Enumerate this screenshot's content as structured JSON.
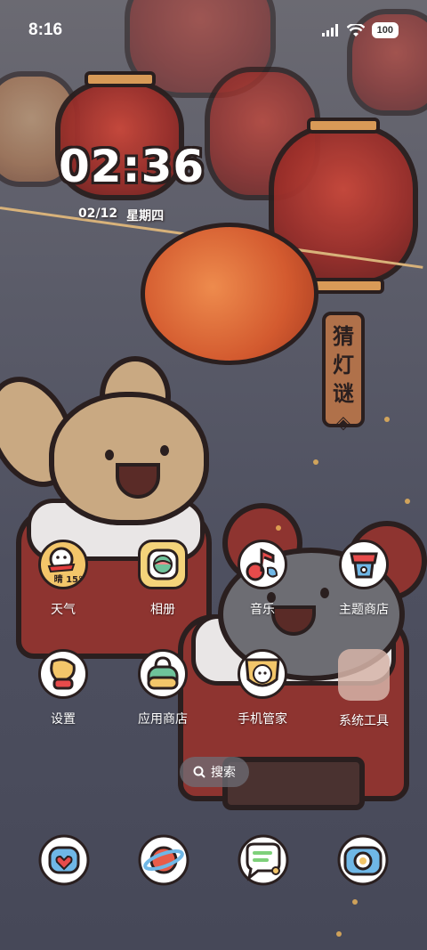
{
  "status_bar": {
    "time": "8:16",
    "battery": "100",
    "icons": [
      "signal-icon",
      "wifi-icon",
      "battery-icon"
    ]
  },
  "clock_widget": {
    "time": "02:36",
    "date": "02/12",
    "weekday": "星期四"
  },
  "wallpaper": {
    "tag_chars": [
      "猜",
      "灯",
      "谜"
    ],
    "tag_symbol": "◈"
  },
  "apps": [
    {
      "id": "weather",
      "label": "天气",
      "icon": "weather-icon",
      "inner_text": "晴 15°",
      "color": "#f3c66a"
    },
    {
      "id": "gallery",
      "label": "相册",
      "icon": "gallery-icon",
      "color": "#f4d37a"
    },
    {
      "id": "music",
      "label": "音乐",
      "icon": "music-icon",
      "color": "#e74b4b"
    },
    {
      "id": "theme-store",
      "label": "主题商店",
      "icon": "theme-store-icon",
      "color": "#6fb7e6"
    },
    {
      "id": "settings",
      "label": "设置",
      "icon": "settings-icon",
      "color": "#f3c66a"
    },
    {
      "id": "app-store",
      "label": "应用商店",
      "icon": "app-store-icon",
      "color": "#e85c4a"
    },
    {
      "id": "phone-manager",
      "label": "手机管家",
      "icon": "phone-manager-icon",
      "color": "#f3c66a"
    },
    {
      "id": "system-tools",
      "label": "系统工具",
      "icon": "folder-icon",
      "color": "#d6b4a8"
    }
  ],
  "search": {
    "label": "搜索"
  },
  "dock": [
    {
      "id": "phone",
      "icon": "phone-icon",
      "color": "#6fb7e6"
    },
    {
      "id": "browser",
      "icon": "browser-icon",
      "color": "#e85c4a"
    },
    {
      "id": "messages",
      "icon": "messages-icon",
      "color": "#7ed07a"
    },
    {
      "id": "camera",
      "icon": "camera-icon",
      "color": "#6fb7e6"
    }
  ]
}
